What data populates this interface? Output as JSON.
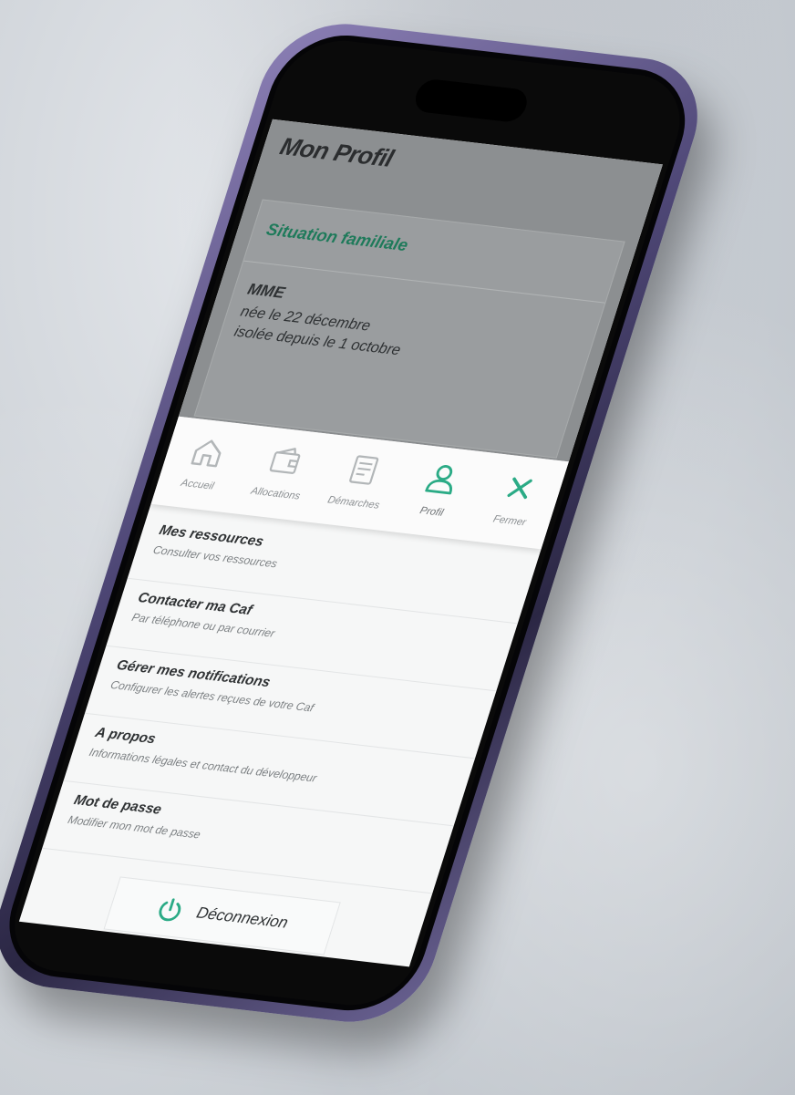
{
  "header": {
    "title": "Mon Profil"
  },
  "situation": {
    "title": "Situation familiale",
    "name": "MME",
    "born": "née le 22 décembre",
    "status": "isolée depuis le 1 octobre"
  },
  "nav": {
    "items": [
      {
        "label": "Accueil",
        "icon": "home-icon"
      },
      {
        "label": "Allocations",
        "icon": "wallet-icon"
      },
      {
        "label": "Démarches",
        "icon": "document-icon"
      },
      {
        "label": "Profil",
        "icon": "user-icon"
      },
      {
        "label": "Fermer",
        "icon": "close-icon"
      }
    ]
  },
  "menu": {
    "items": [
      {
        "title": "Mes ressources",
        "subtitle": "Consulter vos ressources"
      },
      {
        "title": "Contacter ma Caf",
        "subtitle": "Par téléphone ou par courrier"
      },
      {
        "title": "Gérer mes notifications",
        "subtitle": "Configurer les alertes reçues de votre Caf"
      },
      {
        "title": "A propos",
        "subtitle": "Informations légales et contact du développeur"
      },
      {
        "title": "Mot de passe",
        "subtitle": "Modifier mon mot de passe"
      }
    ]
  },
  "logout": {
    "label": "Déconnexion",
    "icon": "power-icon"
  },
  "colors": {
    "accent": "#2bab86",
    "overlay": "#8c8f91",
    "frame": "#4e4776"
  }
}
